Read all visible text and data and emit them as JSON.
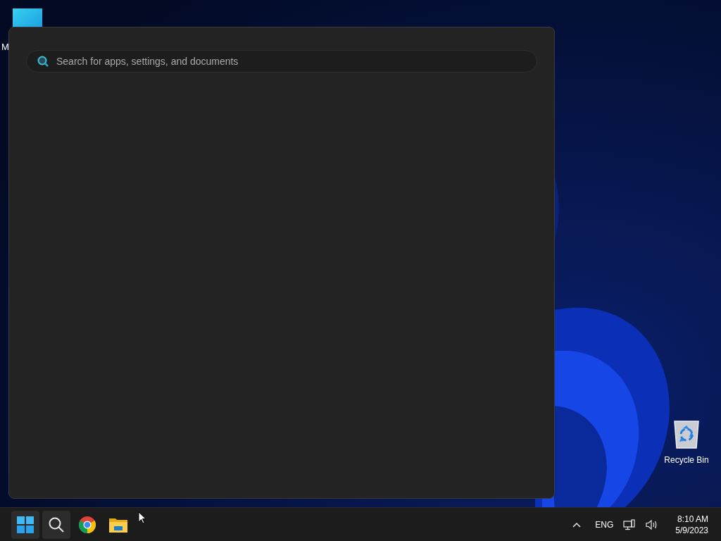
{
  "desktop_icons": [
    {
      "kind": "app",
      "label": "M"
    },
    {
      "kind": "recycle",
      "label": "Recycle Bin"
    }
  ],
  "search_panel": {
    "placeholder": "Search for apps, settings, and documents"
  },
  "taskbar": {
    "apps": [
      {
        "kind": "start",
        "selected": true
      },
      {
        "kind": "search",
        "selected": true
      },
      {
        "kind": "browser",
        "selected": false
      },
      {
        "kind": "folder",
        "selected": false
      }
    ],
    "language": "ENG",
    "time": "8:10 AM",
    "date": "5/9/2023"
  }
}
